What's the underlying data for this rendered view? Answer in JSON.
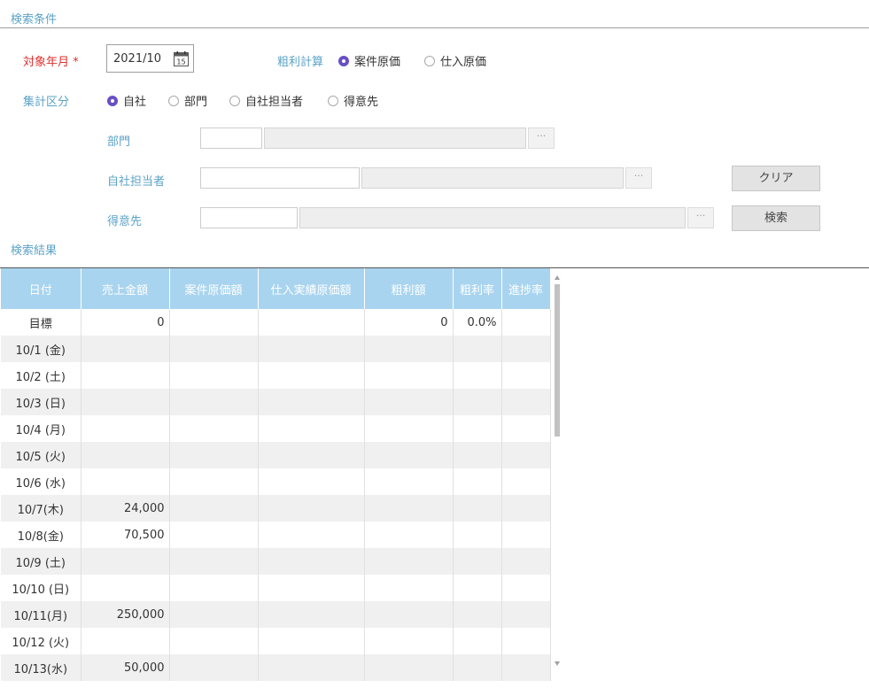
{
  "search": {
    "title": "検索条件",
    "target_month_label": "対象年月",
    "required_mark": "*",
    "target_month_value": "2021/10",
    "calendar_day": "15",
    "gross_calc_label": "粗利計算",
    "gross_calc_options": [
      "案件原価",
      "仕入原価"
    ],
    "aggregate_label": "集計区分",
    "aggregate_options": [
      "自社",
      "部門",
      "自社担当者",
      "得意先"
    ],
    "department_label": "部門",
    "staff_label": "自社担当者",
    "customer_label": "得意先",
    "ellipsis": "···",
    "clear_button": "クリア",
    "search_button": "検索"
  },
  "results": {
    "title": "検索結果",
    "columns": [
      "日付",
      "売上金額",
      "案件原価額",
      "仕入実績原価額",
      "粗利額",
      "粗利率",
      "進捗率"
    ],
    "rows": [
      [
        "目標",
        "0",
        "",
        "",
        "0",
        "0.0%",
        ""
      ],
      [
        "10/1 (金)",
        "",
        "",
        "",
        "",
        "",
        ""
      ],
      [
        "10/2 (土)",
        "",
        "",
        "",
        "",
        "",
        ""
      ],
      [
        "10/3 (日)",
        "",
        "",
        "",
        "",
        "",
        ""
      ],
      [
        "10/4 (月)",
        "",
        "",
        "",
        "",
        "",
        ""
      ],
      [
        "10/5 (火)",
        "",
        "",
        "",
        "",
        "",
        ""
      ],
      [
        "10/6 (水)",
        "",
        "",
        "",
        "",
        "",
        ""
      ],
      [
        "10/7(木)",
        "24,000",
        "",
        "",
        "",
        "",
        ""
      ],
      [
        "10/8(金)",
        "70,500",
        "",
        "",
        "",
        "",
        ""
      ],
      [
        "10/9 (土)",
        "",
        "",
        "",
        "",
        "",
        ""
      ],
      [
        "10/10 (日)",
        "",
        "",
        "",
        "",
        "",
        ""
      ],
      [
        "10/11(月)",
        "250,000",
        "",
        "",
        "",
        "",
        ""
      ],
      [
        "10/12 (火)",
        "",
        "",
        "",
        "",
        "",
        ""
      ],
      [
        "10/13(水)",
        "50,000",
        "",
        "",
        "",
        "",
        ""
      ]
    ]
  }
}
